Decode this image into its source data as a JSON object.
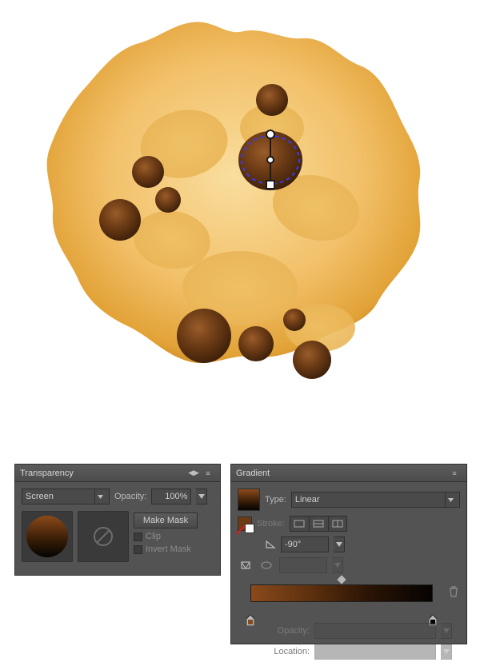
{
  "transparency": {
    "title": "Transparency",
    "blend_mode": "Screen",
    "opacity_label": "Opacity:",
    "opacity_value": "100%",
    "make_mask": "Make Mask",
    "clip": "Clip",
    "invert_mask": "Invert Mask"
  },
  "gradient": {
    "title": "Gradient",
    "type_label": "Type:",
    "type_value": "Linear",
    "stroke_label": "Stroke:",
    "angle_value": "-90°",
    "opacity_label": "Opacity:",
    "location_label": "Location:"
  }
}
